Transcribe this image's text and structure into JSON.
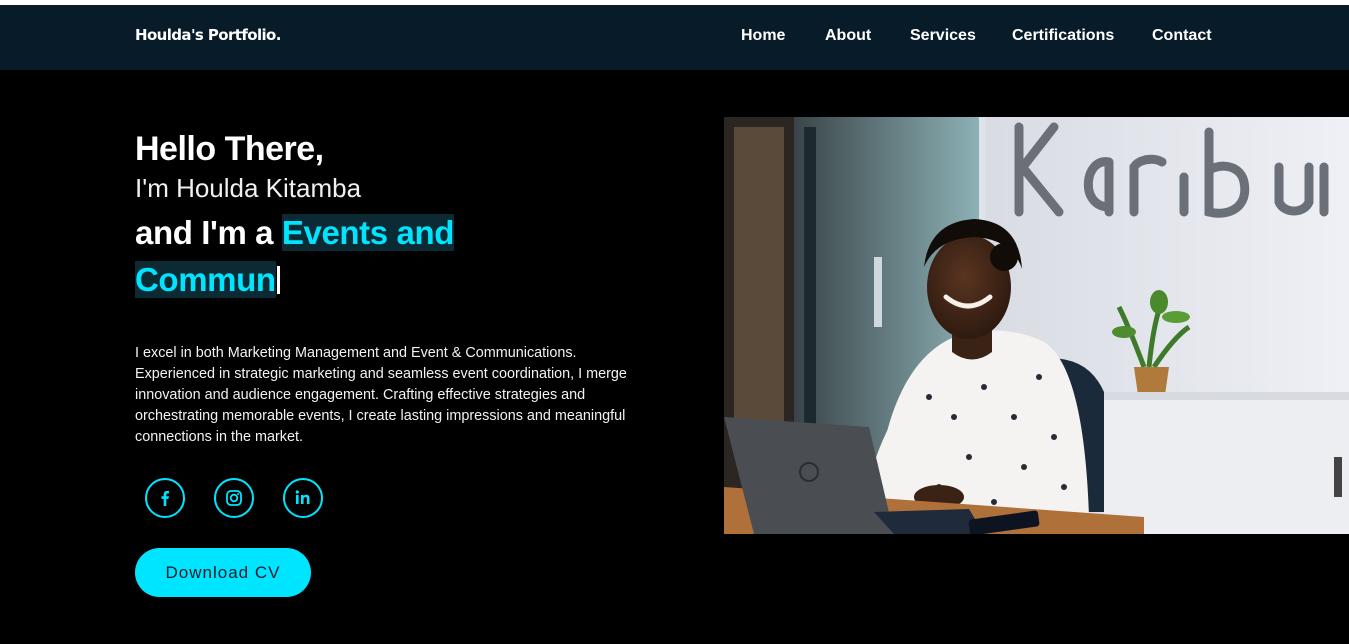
{
  "nav": {
    "logo": "Houlda's Portfolio.",
    "links": [
      "Home",
      "About",
      "Services",
      "Certifications",
      "Contact"
    ]
  },
  "hero": {
    "greeting": "Hello There,",
    "name": "I'm Houlda Kitamba",
    "role_prefix": "and I'm a",
    "role_typed": "Events and Commun",
    "description": "I excel in both Marketing Management and Event & Communications. Experienced in strategic marketing and seamless event coordination, I merge innovation and audience engagement. Crafting effective strategies and orchestrating memorable events, I create lasting impressions and meaningful connections in the market.",
    "cv_button": "Download CV",
    "photo_wall_text": "Karibu"
  },
  "social": [
    "facebook-icon",
    "instagram-icon",
    "linkedin-icon"
  ],
  "colors": {
    "accent": "#00e5ff",
    "nav_bg": "#081b29",
    "page_bg": "#000000"
  }
}
